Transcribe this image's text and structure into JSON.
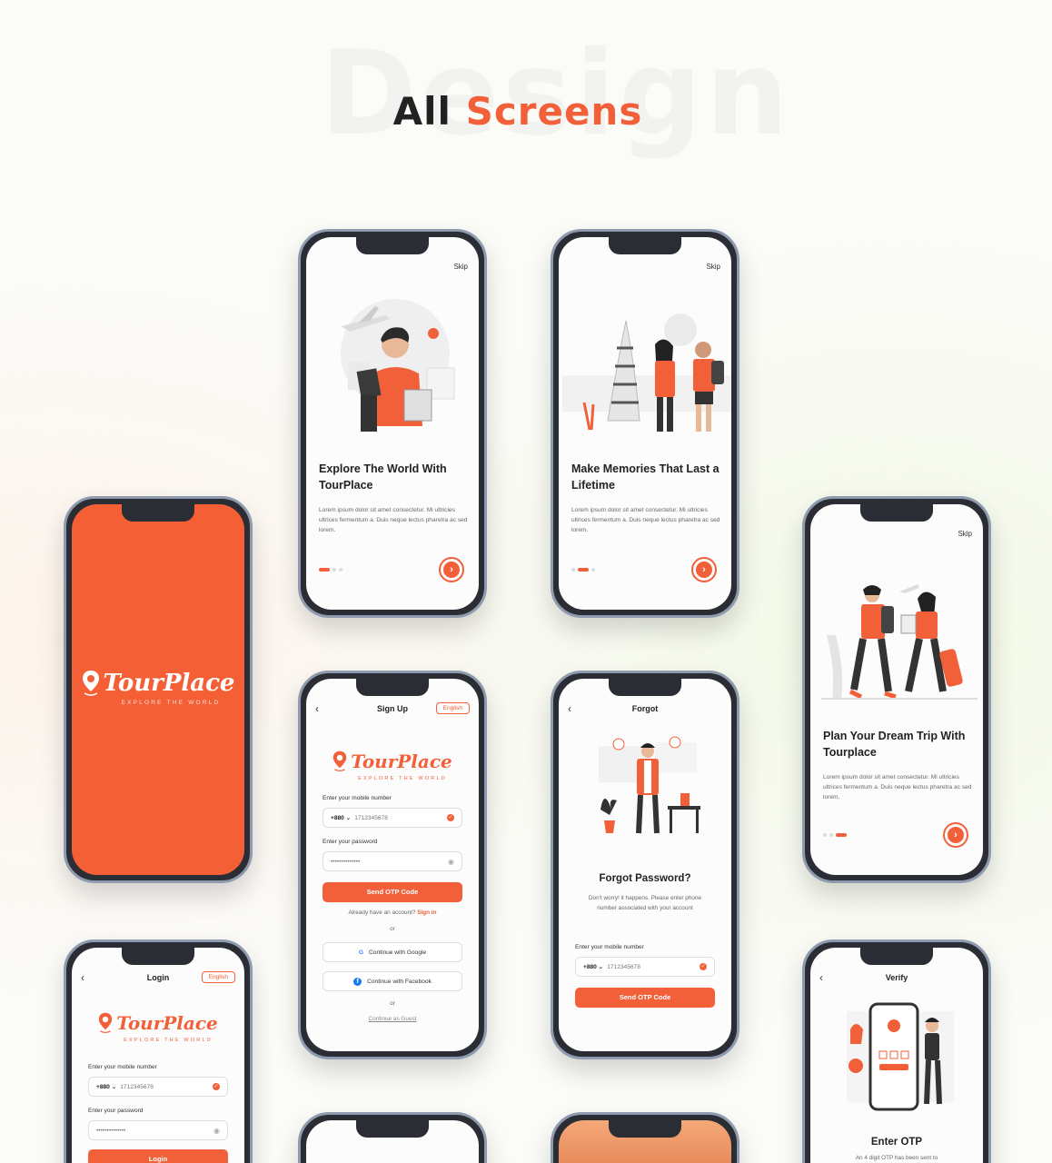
{
  "header": {
    "bg_word": "Design",
    "title_dark": "All",
    "title_accent": "Screens"
  },
  "colors": {
    "accent": "#f2603a",
    "splash_bg": "#f55f35"
  },
  "brand": {
    "name": "TourPlace",
    "tagline": "EXPLORE THE WORLD"
  },
  "common": {
    "skip": "Skip",
    "next_icon": "›",
    "back_icon": "‹"
  },
  "onboarding": [
    {
      "title": "Explore The World With TourPlace",
      "body": "Lorem ipsum dolor sit amet consectetur. Mi ultricies ultrices fermentum a. Duis neque lectus pharetra ac sed lorem."
    },
    {
      "title": "Make Memories That Last a Lifetime",
      "body": "Lorem ipsum dolor sit amet consectetur. Mi ultricies ultrices fermentum a. Duis neque lectus pharetra ac sed lorem."
    },
    {
      "title": "Plan Your Dream Trip With Tourplace",
      "body": "Lorem ipsum dolor sit amet consectetur. Mi ultricies ultrices fermentum a. Duis neque lectus pharetra ac sed lorem."
    }
  ],
  "signup": {
    "title": "Sign Up",
    "language": "English",
    "mobile_label": "Enter your mobile number",
    "country_code": "+880 ⌄",
    "mobile_value": "1712345678",
    "password_label": "Enter your password",
    "password_value": "••••••••••••••",
    "submit": "Send OTP Code",
    "have_account": "Already have an account?",
    "signin": "Sign in",
    "or": "or",
    "google": "Continue with Google",
    "facebook": "Continue with Facebook",
    "guest": "Continue as Guest"
  },
  "forgot": {
    "title": "Forgot",
    "heading": "Forgot Password?",
    "desc": "Don't worry! it happens. Please enter phone number associated with your account",
    "mobile_label": "Enter your mobile number",
    "country_code": "+880 ⌄",
    "mobile_value": "1712345678",
    "submit": "Send OTP Code"
  },
  "login": {
    "title": "Login",
    "language": "English",
    "mobile_label": "Enter your mobile number",
    "country_code": "+880 ⌄",
    "mobile_value": "1712345678",
    "password_label": "Enter your password",
    "password_value": "••••••••••••••",
    "submit": "Login"
  },
  "verify": {
    "title": "Verify",
    "heading": "Enter OTP",
    "desc": "An 4 digit OTP has been sent to",
    "illus_title": "Enter OTP",
    "illus_button": "Verify"
  }
}
